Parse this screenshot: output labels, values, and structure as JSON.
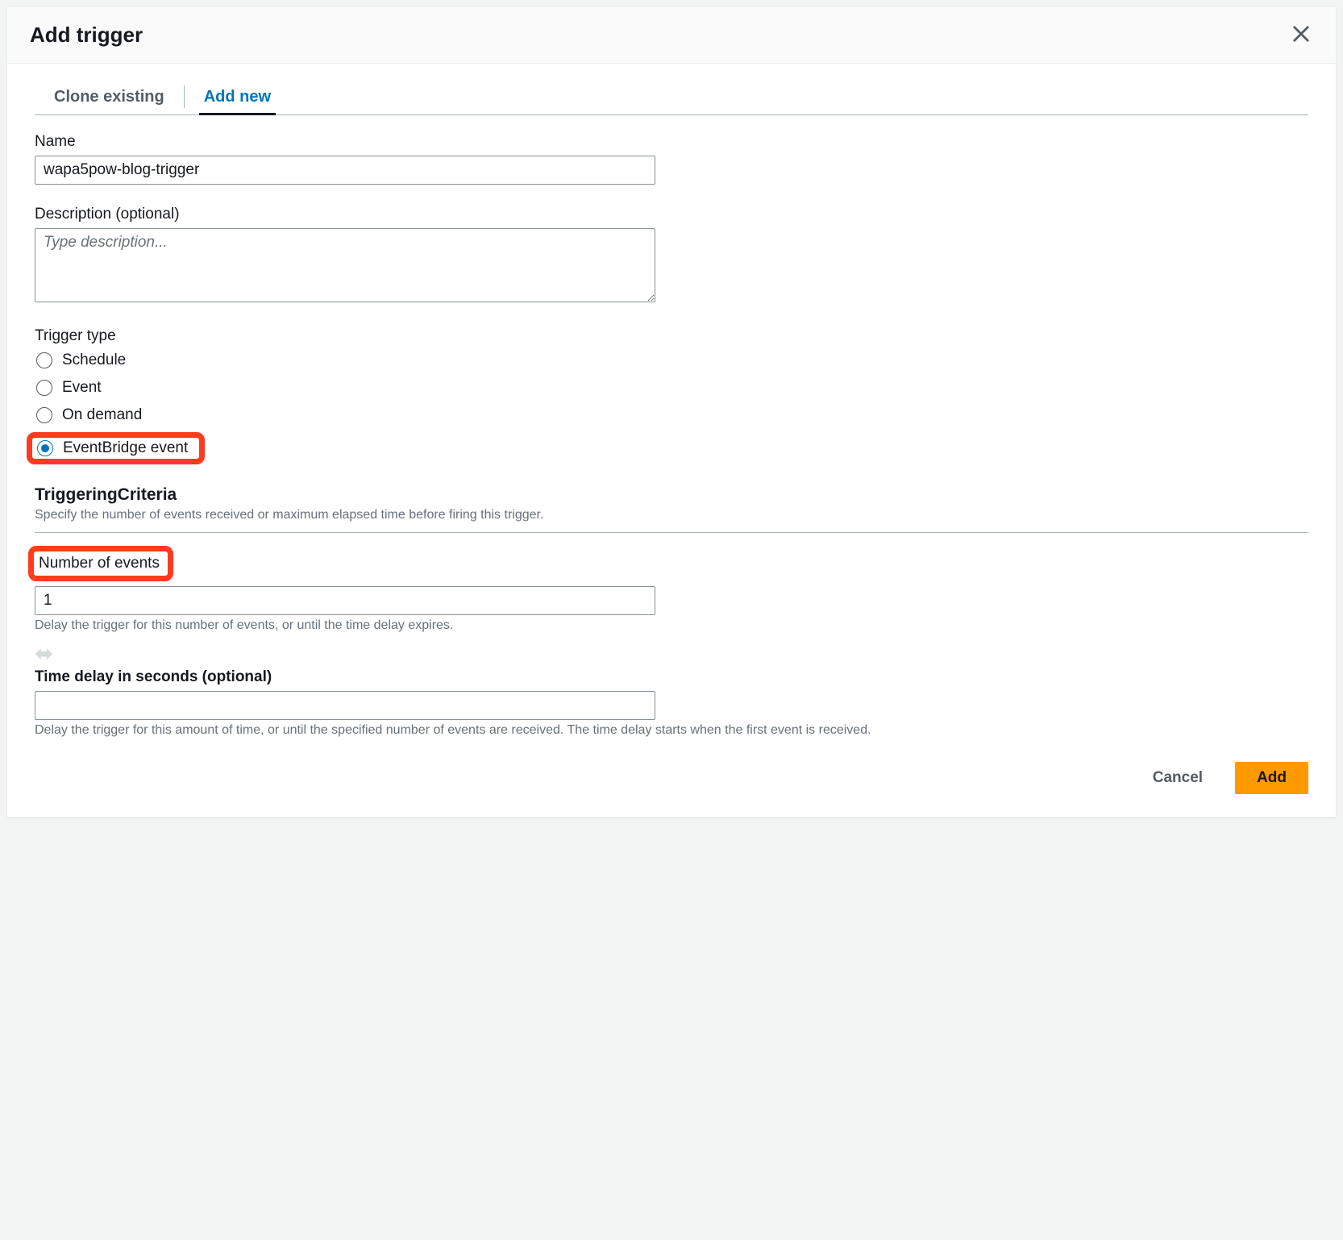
{
  "header": {
    "title": "Add trigger"
  },
  "tabs": [
    {
      "label": "Clone existing",
      "active": false
    },
    {
      "label": "Add new",
      "active": true
    }
  ],
  "name": {
    "label": "Name",
    "value": "wapa5pow-blog-trigger"
  },
  "description": {
    "label": "Description (optional)",
    "placeholder": "Type description...",
    "value": ""
  },
  "trigger_type": {
    "label": "Trigger type",
    "options": [
      {
        "label": "Schedule",
        "selected": false
      },
      {
        "label": "Event",
        "selected": false
      },
      {
        "label": "On demand",
        "selected": false
      },
      {
        "label": "EventBridge event",
        "selected": true,
        "highlighted": true
      }
    ]
  },
  "criteria": {
    "heading": "TriggeringCriteria",
    "description": "Specify the number of events received or maximum elapsed time before firing this trigger."
  },
  "num_events": {
    "label": "Number of events",
    "value": "1",
    "helper": "Delay the trigger for this number of events, or until the time delay expires."
  },
  "time_delay": {
    "label": "Time delay in seconds (optional)",
    "value": "",
    "helper": "Delay the trigger for this amount of time, or until the specified number of events are received. The time delay starts when the first event is received."
  },
  "footer": {
    "cancel": "Cancel",
    "submit": "Add"
  }
}
